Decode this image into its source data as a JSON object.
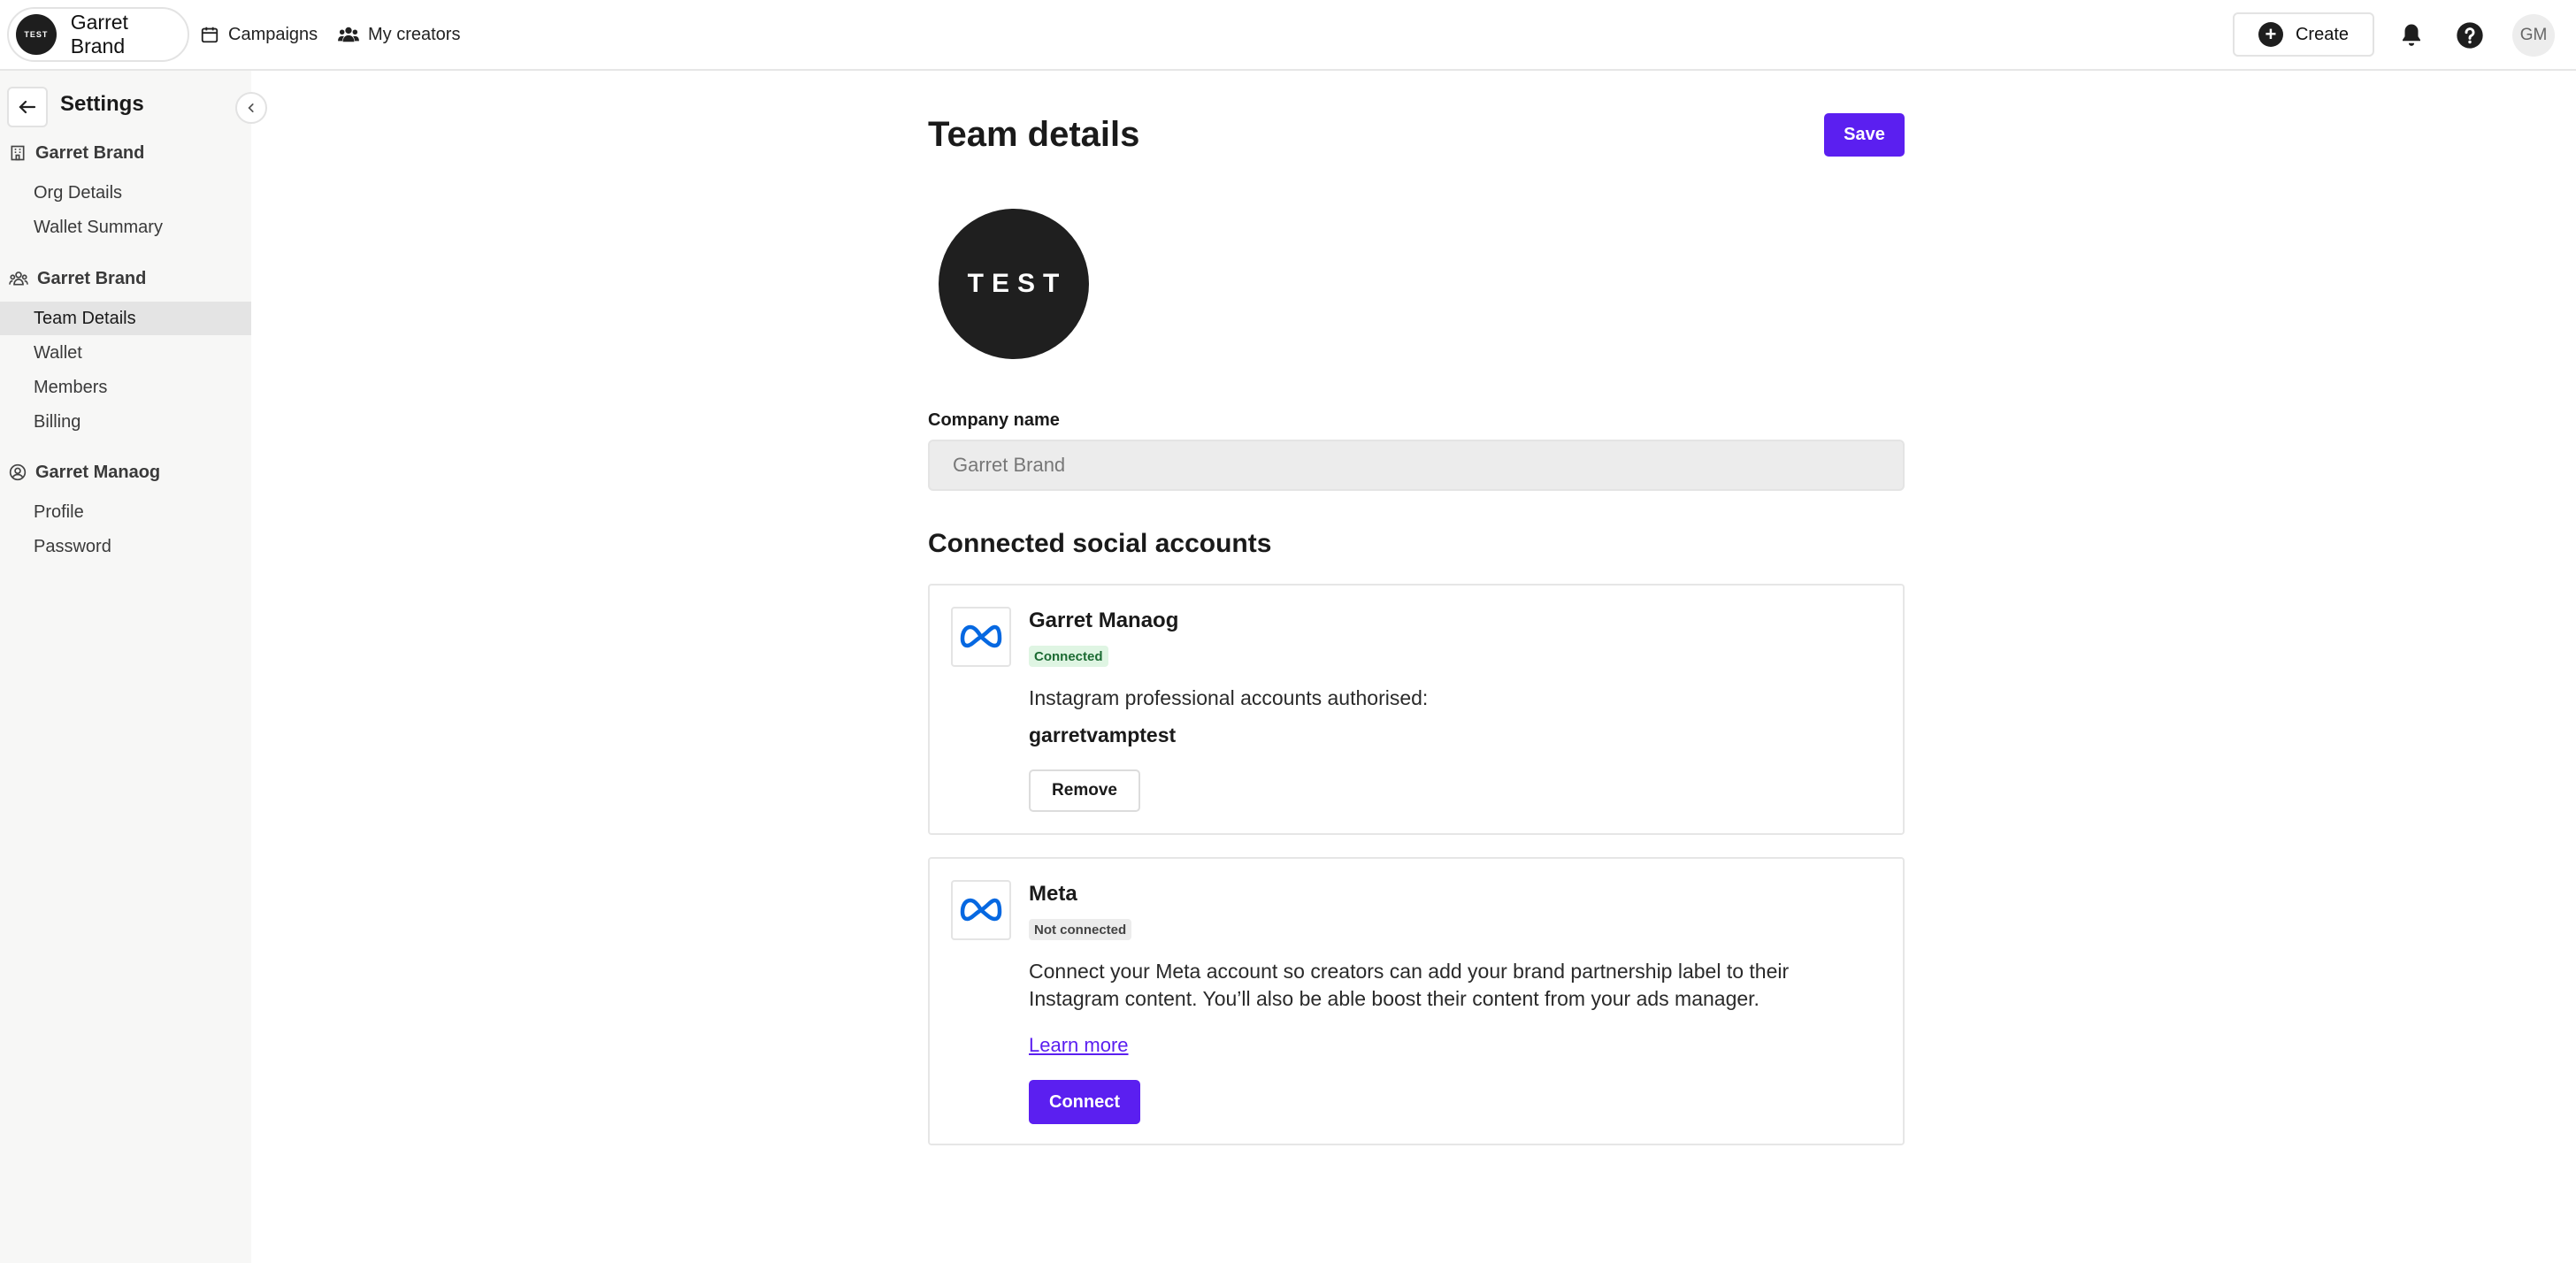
{
  "topbar": {
    "brand_logo_text": "TEST",
    "brand_name": "Garret Brand",
    "nav": [
      {
        "label": "Campaigns",
        "icon": "calendar-icon"
      },
      {
        "label": "My creators",
        "icon": "people-icon"
      }
    ],
    "create_label": "Create",
    "avatar_initials": "GM"
  },
  "sidebar": {
    "title": "Settings",
    "groups": [
      {
        "label": "Garret Brand",
        "icon": "building-icon",
        "items": [
          "Org Details",
          "Wallet Summary"
        ]
      },
      {
        "label": "Garret Brand",
        "icon": "team-icon",
        "items": [
          "Team Details",
          "Wallet",
          "Members",
          "Billing"
        ]
      },
      {
        "label": "Garret Manaog",
        "icon": "user-circle-icon",
        "items": [
          "Profile",
          "Password"
        ]
      }
    ],
    "active_item": "Team Details"
  },
  "main": {
    "title": "Team details",
    "save_label": "Save",
    "team_logo_text": "TEST",
    "company_label": "Company name",
    "company_value": "Garret Brand",
    "social_title": "Connected social accounts",
    "accounts": [
      {
        "name": "Garret Manaog",
        "status": "Connected",
        "description": "Instagram professional accounts authorised:",
        "handle": "garretvamptest",
        "action": "Remove"
      },
      {
        "name": "Meta",
        "status": "Not connected",
        "description": "Connect your Meta account so creators can add your brand partnership label to their Instagram content. You’ll also be able boost their content from your ads manager.",
        "link": "Learn more",
        "action": "Connect"
      }
    ]
  },
  "colors": {
    "accent": "#5b1ff0",
    "connected_bg": "#dff5e3",
    "connected_text": "#1c6b33",
    "sidebar_bg": "#f7f7f6",
    "meta_blue": "#0668E1"
  }
}
